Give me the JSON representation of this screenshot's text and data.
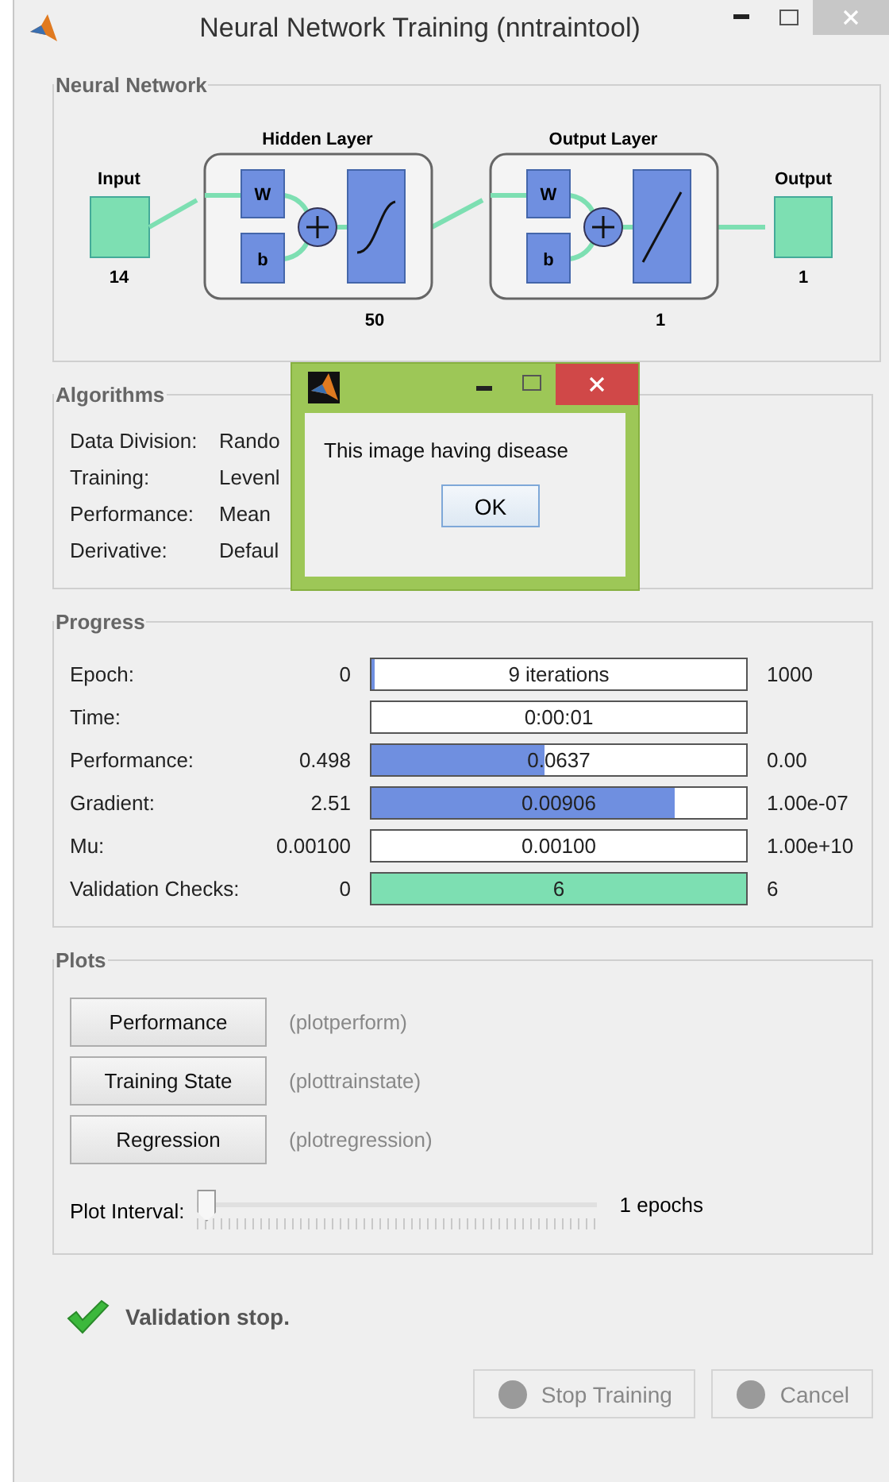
{
  "window": {
    "title": "Neural Network Training (nntraintool)"
  },
  "network": {
    "title": "Neural Network",
    "input_label": "Input",
    "input_size": "14",
    "hidden_title": "Hidden Layer",
    "hidden_w": "W",
    "hidden_b": "b",
    "hidden_size": "50",
    "output_layer_title": "Output Layer",
    "output_w": "W",
    "output_b": "b",
    "output_layer_size": "1",
    "output_label": "Output",
    "output_size": "1"
  },
  "algorithms": {
    "title": "Algorithms",
    "rows": [
      {
        "label": "Data Division:",
        "value": "Rando"
      },
      {
        "label": "Training:",
        "value": "Levenl"
      },
      {
        "label": "Performance:",
        "value": "Mean"
      },
      {
        "label": "Derivative:",
        "value": "Defaul"
      }
    ]
  },
  "progress": {
    "title": "Progress",
    "rows": [
      {
        "label": "Epoch:",
        "start": "0",
        "reading": "9 iterations",
        "level": 0.01,
        "color": "#6f8fe0",
        "end": "1000"
      },
      {
        "label": "Time:",
        "reading": "0:00:01"
      },
      {
        "label": "Performance:",
        "start": "0.498",
        "reading": "0.0637",
        "level": 0.46,
        "color": "#6f8fe0",
        "end": "0.00"
      },
      {
        "label": "Gradient:",
        "start": "2.51",
        "reading": "0.00906",
        "level": 0.81,
        "color": "#6f8fe0",
        "end": "1.00e-07"
      },
      {
        "label": "Mu:",
        "start": "0.00100",
        "reading": "0.00100",
        "end": "1.00e+10"
      },
      {
        "label": "Validation Checks:",
        "start": "0",
        "reading": "6",
        "level": 1,
        "color": "#7ddfb2",
        "end": "6"
      }
    ]
  },
  "plots": {
    "title": "Plots",
    "buttons": [
      {
        "label": "Performance",
        "function": "(plotperform)"
      },
      {
        "label": "Training State",
        "function": "(plottrainstate)"
      },
      {
        "label": "Regression",
        "function": "(plotregression)"
      }
    ],
    "interval": {
      "label": "Plot Interval:",
      "level": 0,
      "reading": "1 epochs"
    }
  },
  "status": {
    "text": "Validation stop."
  },
  "buttons": [
    {
      "label": "Stop Training",
      "disabled": true
    },
    {
      "label": "Cancel",
      "disabled": true
    }
  ],
  "dialog": {
    "message": "This image having disease",
    "button": "OK"
  }
}
